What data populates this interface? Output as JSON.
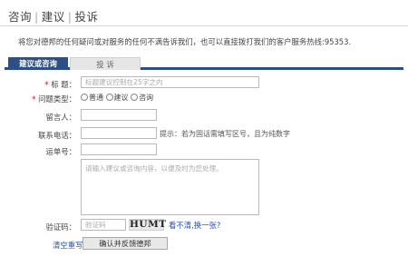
{
  "header": {
    "tab_advice": "咨询",
    "tab_suggest": "建议",
    "tab_complaint": "投诉",
    "separator": "|"
  },
  "notice": "将您对德邦的任何疑问或对服务的任何不满告诉我们，也可以直接拨打我们的客户服务热线:95353.",
  "tabs": {
    "active": "建议或咨询",
    "inactive": "投 诉"
  },
  "form": {
    "required_mark": "*",
    "title_label": "标 题：",
    "title_placeholder": "标题建议控制在25字之内",
    "type_label": "问题类型：",
    "type_options": [
      "普通",
      "建议",
      "咨询"
    ],
    "name_label": "留言人：",
    "phone_label": "联系电话：",
    "phone_hint": "提示：若为固话需填写区号，且为纯数字",
    "waybill_label": "运单号：",
    "content_placeholder": "请输入建议或咨询内容，以便及时为您处理。",
    "captcha_label": "验证码：",
    "captcha_placeholder": "验证码",
    "captcha_text": "HUMT",
    "refresh_text": "看不清,换一张?",
    "clear_text": "清空重写",
    "submit_text": "确认并反馈德邦"
  }
}
